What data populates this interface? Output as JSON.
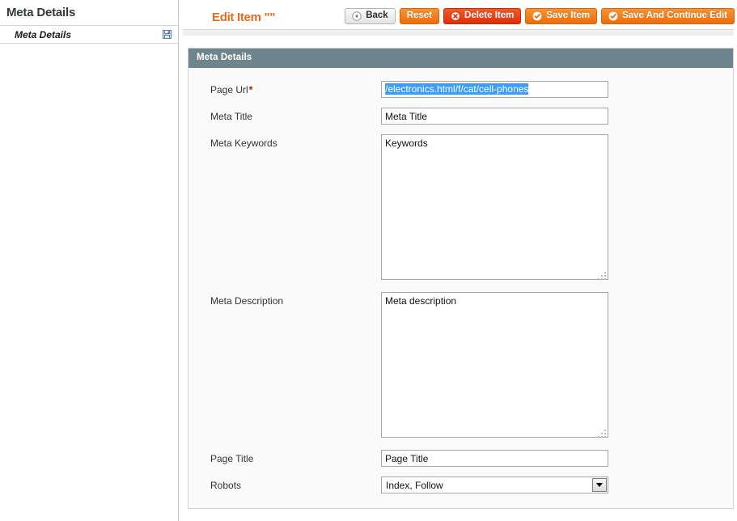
{
  "sidebar": {
    "title": "Meta Details",
    "items": [
      {
        "label": "Meta Details",
        "icon": "save-floppy-icon"
      }
    ]
  },
  "header": {
    "page_title": "Edit Item \"\"",
    "buttons": [
      {
        "name": "back-button",
        "label": "Back",
        "style": "grey",
        "icon": "back-arrow-circle-icon"
      },
      {
        "name": "reset-button",
        "label": "Reset",
        "style": "orange",
        "icon": "none"
      },
      {
        "name": "delete-button",
        "label": "Delete Item",
        "style": "red",
        "icon": "delete-x-circle-icon"
      },
      {
        "name": "save-button",
        "label": "Save Item",
        "style": "orange",
        "icon": "check-circle-icon"
      },
      {
        "name": "save-continue-button",
        "label": "Save And Continue Edit",
        "style": "orange",
        "icon": "check-circle-icon"
      }
    ]
  },
  "panel": {
    "legend": "Meta Details",
    "fields": [
      {
        "name": "page-url",
        "label": "Page Url",
        "required": true,
        "required_mark": "*",
        "type": "text-selected",
        "value": "/electronics.html/f/cat/cell-phones",
        "placeholder": ""
      },
      {
        "name": "meta-title",
        "label": "Meta Title",
        "required": false,
        "required_mark": "",
        "type": "text",
        "value": "Meta Title",
        "placeholder": "Meta Title"
      },
      {
        "name": "meta-keywords",
        "label": "Meta Keywords",
        "required": false,
        "required_mark": "",
        "type": "textarea",
        "value": "Keywords",
        "placeholder": "Keywords"
      },
      {
        "name": "meta-description",
        "label": "Meta Description",
        "required": false,
        "required_mark": "",
        "type": "textarea",
        "value": "Meta description",
        "placeholder": "Meta description"
      },
      {
        "name": "page-title",
        "label": "Page Title",
        "required": false,
        "required_mark": "",
        "type": "text",
        "value": "Page Title",
        "placeholder": "Page Title"
      },
      {
        "name": "robots",
        "label": "Robots",
        "required": false,
        "required_mark": "",
        "type": "select",
        "value": "Index, Follow",
        "placeholder": ""
      }
    ]
  },
  "colors": {
    "accent_orange": "#e8691c",
    "button_orange": "#ec6c0b",
    "button_red": "#dd2f08",
    "panel_header": "#6f858e",
    "selection_blue": "#3b9dfb",
    "required_red": "#d40000"
  }
}
